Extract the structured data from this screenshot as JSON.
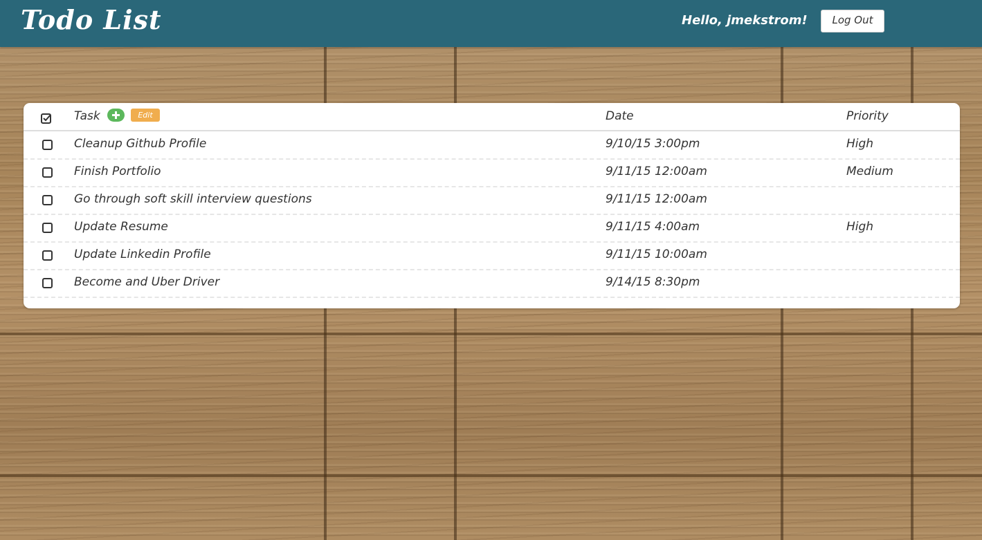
{
  "header": {
    "title": "Todo List",
    "greeting": "Hello, jmekstrom!",
    "logout_label": "Log Out",
    "background_color": "#2a6779"
  },
  "table": {
    "columns": {
      "task": "Task",
      "date": "Date",
      "priority": "Priority"
    },
    "edit_label": "Edit",
    "add_icon": "plus-circle-icon",
    "rows": [
      {
        "task": "Cleanup Github Profile",
        "date": "9/10/15 3:00pm",
        "priority": "High"
      },
      {
        "task": "Finish Portfolio",
        "date": "9/11/15 12:00am",
        "priority": "Medium"
      },
      {
        "task": "Go through soft skill interview questions",
        "date": "9/11/15 12:00am",
        "priority": ""
      },
      {
        "task": "Update Resume",
        "date": "9/11/15 4:00am",
        "priority": "High"
      },
      {
        "task": "Update Linkedin Profile",
        "date": "9/11/15 10:00am",
        "priority": ""
      },
      {
        "task": "Become and Uber Driver",
        "date": "9/14/15 8:30pm",
        "priority": ""
      }
    ]
  },
  "colors": {
    "add_button": "#5cb85c",
    "edit_button": "#f0ad4e"
  }
}
